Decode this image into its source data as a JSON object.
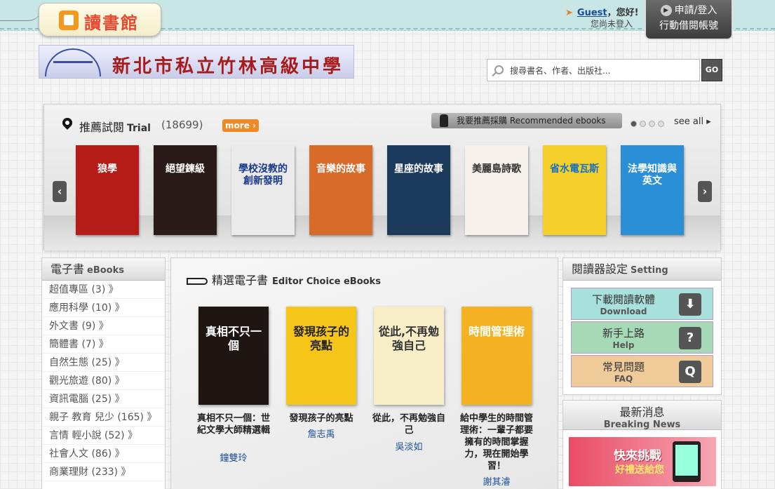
{
  "header": {
    "logo_text": "讀書館",
    "guest_name": "Guest",
    "greeting": "，您好!",
    "status": "您尚未登入",
    "login_line1": "申請/登入",
    "login_line2": "行動借閱帳號"
  },
  "school": {
    "name": "新北市私立竹林高級中學"
  },
  "search": {
    "placeholder": "搜尋書名、作者、出版社...",
    "go_label": "GO"
  },
  "recommend": {
    "title": "推薦試閱",
    "title_en": "Trial",
    "count": "(18699)",
    "more_label": "more",
    "recommend_btn": "我要推薦採購  Recommended ebooks",
    "see_all": "see all",
    "books": [
      {
        "title": "狼學",
        "bg": "#b51c18",
        "fg": "#fff"
      },
      {
        "title": "絕望鍊級",
        "bg": "#2a1a1a",
        "fg": "#fff"
      },
      {
        "title": "學校沒教的創新發明",
        "bg": "#eaeaea",
        "fg": "#1a3a8a"
      },
      {
        "title": "音樂的故事",
        "bg": "#d86a2a",
        "fg": "#fff"
      },
      {
        "title": "星座的故事",
        "bg": "#1c3b5c",
        "fg": "#fff"
      },
      {
        "title": "美麗島詩歌",
        "bg": "#f5f1ea",
        "fg": "#333"
      },
      {
        "title": "省水電瓦斯",
        "bg": "#f6d02a",
        "fg": "#1a6fc2"
      },
      {
        "title": "法學知識與英文",
        "bg": "#2a8fd6",
        "fg": "#fff"
      }
    ]
  },
  "ebooks_panel": {
    "title": "電子書",
    "title_en": "eBooks",
    "categories": [
      "超值專區 (3) 》",
      "應用科學 (10) 》",
      "外文書 (9) 》",
      "簡體書 (7) 》",
      "自然生態 (25) 》",
      "觀光旅遊 (80) 》",
      "資訊電腦 (25) 》",
      "親子 教育 兒少 (165) 》",
      "言情 輕小說 (52) 》",
      "社會人文 (86) 》",
      "商業理財 (233) 》"
    ]
  },
  "editor_choice": {
    "title": "精選電子書",
    "title_en": "Editor Choice eBooks",
    "books": [
      {
        "cover_text": "真相不只一個",
        "title": "真相不只一個：世紀文學大師精選輯",
        "author": "鐘雙玲",
        "bg": "#1e1612",
        "fg": "#fff"
      },
      {
        "cover_text": "發現孩子的亮點",
        "title": "發現孩子的亮點",
        "author": "詹志禹",
        "bg": "#f5c518",
        "fg": "#222"
      },
      {
        "cover_text": "從此,不再勉強自己",
        "title": "從此，不再勉強自己",
        "author": "吳淡如",
        "bg": "#f7eec8",
        "fg": "#333"
      },
      {
        "cover_text": "時間管理術",
        "title": "給中學生的時間管理術：一輩子都要擁有的時間掌握力，現在開始學習！",
        "author": "謝其濬",
        "bg": "#f4b223",
        "fg": "#fff"
      }
    ]
  },
  "reader_settings": {
    "title": "閱讀器設定",
    "title_en": "Setting",
    "items": [
      {
        "zh": "下載閱讀軟體",
        "en": "Download",
        "bg": "#a8e0dc"
      },
      {
        "zh": "新手上路",
        "en": "Help",
        "bg": "#a6dab6"
      },
      {
        "zh": "常見問題",
        "en": "FAQ",
        "bg": "#f0cb9a"
      }
    ]
  },
  "news": {
    "title": "最新消息",
    "title_en": "Breaking News",
    "banner_text": "快來挑戰",
    "banner_sub": "好禮送給您"
  }
}
